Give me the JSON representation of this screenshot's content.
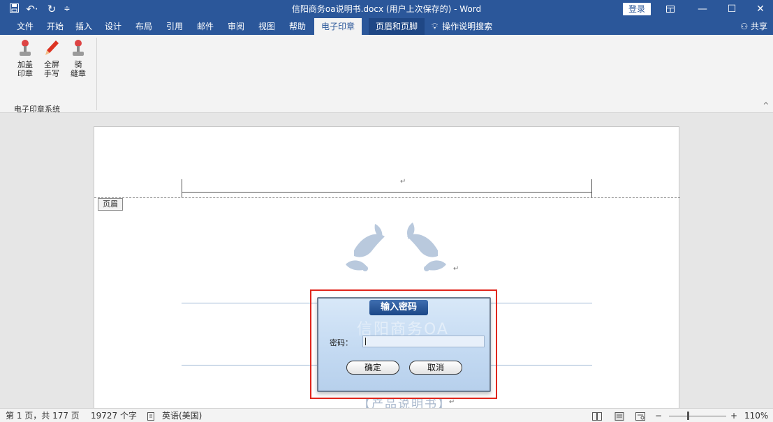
{
  "title_bar": {
    "title": "信阳商务oa说明书.docx (用户上次保存的)  -  Word",
    "login_label": "登录",
    "icons": [
      "save-icon",
      "undo-icon",
      "redo-icon",
      "customize-qat-icon",
      "ribbon-display-icon",
      "minimize-icon",
      "maximize-icon",
      "close-icon"
    ]
  },
  "tabs": [
    {
      "label": "文件"
    },
    {
      "label": "开始"
    },
    {
      "label": "插入"
    },
    {
      "label": "设计"
    },
    {
      "label": "布局"
    },
    {
      "label": "引用"
    },
    {
      "label": "邮件"
    },
    {
      "label": "审阅"
    },
    {
      "label": "视图"
    },
    {
      "label": "帮助"
    },
    {
      "label": "电子印章"
    },
    {
      "label": "页眉和页脚"
    }
  ],
  "search_label": "操作说明搜索",
  "share_label": "共享",
  "ribbon": {
    "buttons": [
      {
        "line1": "加盖",
        "line2": "印章",
        "icon": "stamp-icon"
      },
      {
        "line1": "全屏",
        "line2": "手写",
        "icon": "pencil-icon"
      },
      {
        "line1": "骑",
        "line2": "缝章",
        "icon": "stamp-icon"
      }
    ],
    "group_label": "电子印章系统"
  },
  "document": {
    "header_tag": "页眉",
    "para_mark": "↵",
    "manual_title": "【产品说明书】"
  },
  "dialog": {
    "title": "输入密码",
    "watermark": "信阳商务OA",
    "password_label": "密码：",
    "password_value": "",
    "ok_label": "确定",
    "cancel_label": "取消"
  },
  "status_bar": {
    "page_info": "第 1 页，共 177 页",
    "word_count": "19727 个字",
    "language": "英语(美国)",
    "zoom_minus": "−",
    "zoom_plus": "+",
    "zoom": "110%",
    "zoom_fraction": 0.33
  },
  "colors": {
    "accent": "#2b579a",
    "highlight_border": "#e0261c",
    "dialog_title": "#2a5a9c"
  }
}
